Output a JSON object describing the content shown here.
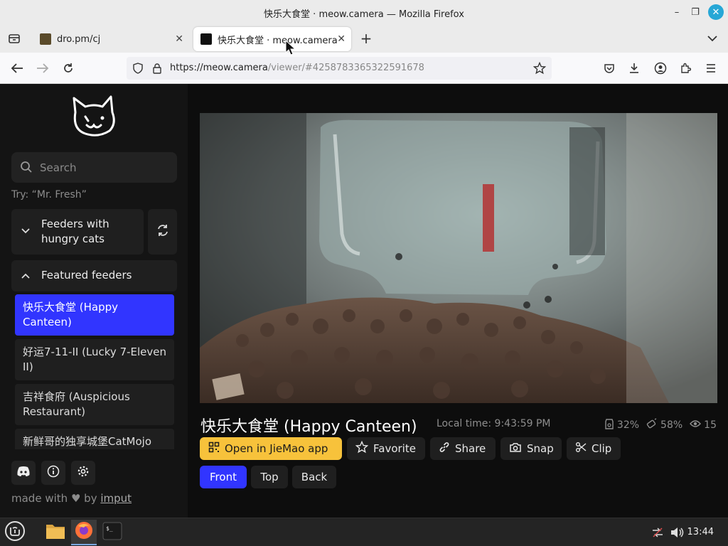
{
  "window": {
    "title": "快乐大食堂 · meow.camera — Mozilla Firefox"
  },
  "tabs": [
    {
      "title": "dro.pm/cj"
    },
    {
      "title": "快乐大食堂 · meow.camera"
    }
  ],
  "navbar": {
    "url_host": "https://meow.camera",
    "url_path": "/viewer/#4258783365322591678"
  },
  "sidebar": {
    "search_placeholder": "Search",
    "try_hint": "Try: “Mr. Fresh”",
    "hungry_group": "Feeders with hungry cats",
    "featured_group": "Featured feeders",
    "feeders": [
      {
        "name": "快乐大食堂 (Happy Canteen)"
      },
      {
        "name": "好运7-11-II (Lucky 7-Eleven II)"
      },
      {
        "name": "吉祥食府 (Auspicious Restaurant)"
      },
      {
        "name": "新鲜哥的独享城堡CatMojo"
      }
    ],
    "made_with": "made with",
    "by": "by",
    "author": "imput"
  },
  "viewer": {
    "title": "快乐大食堂 (Happy Canteen)",
    "local_time": "Local time: 9:43:59 PM",
    "stats": {
      "food": "32%",
      "battery": "58%",
      "viewers": "15"
    },
    "actions": {
      "open_app": "Open in JieMao app",
      "favorite": "Favorite",
      "share": "Share",
      "snap": "Snap",
      "clip": "Clip"
    },
    "views": {
      "front": "Front",
      "top": "Top",
      "back": "Back"
    }
  },
  "taskbar": {
    "clock": "13:44"
  },
  "colors": {
    "accent": "#3135ff",
    "yellow": "#f7c23b",
    "sidebar_bg": "#141414"
  }
}
